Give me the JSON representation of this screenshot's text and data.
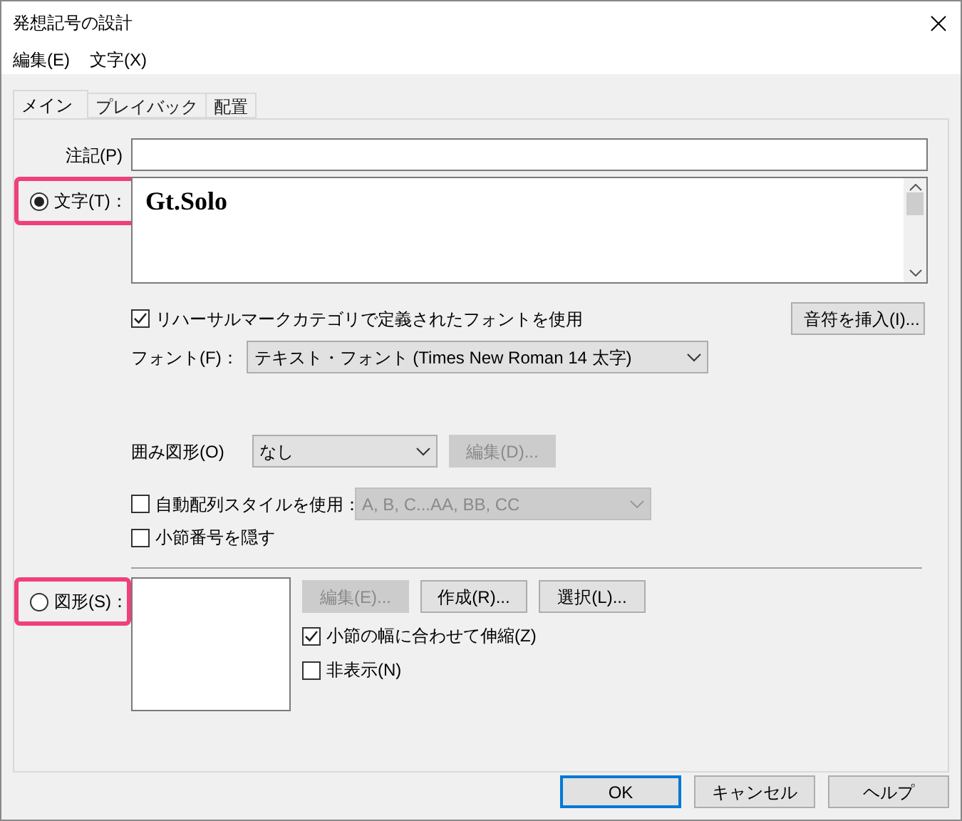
{
  "window": {
    "title": "発想記号の設計"
  },
  "menu": [
    "編集(E)",
    "文字(X)"
  ],
  "tabs": [
    {
      "label": "メイン",
      "selected": true
    },
    {
      "label": "プレイバック",
      "selected": false
    },
    {
      "label": "配置",
      "selected": false
    }
  ],
  "annotation": {
    "label": "注記(P)"
  },
  "text_option": {
    "label": "文字(T)：",
    "selected": true,
    "value": "Gt.Solo",
    "highlighted": true
  },
  "rehearsal_font": {
    "label": "リハーサルマークカテゴリで定義されたフォントを使用",
    "checked": true
  },
  "insert_note_button": "音符を挿入(I)...",
  "font": {
    "label": "フォント(F)：",
    "value": "テキスト・フォント (Times New Roman 14 太字)"
  },
  "enclosure": {
    "label": "囲み図形(O)",
    "value": "なし",
    "edit_button": {
      "label": "編集(D)...",
      "disabled": true
    }
  },
  "auto_sequence": {
    "label": "自動配列スタイルを使用：",
    "checked": false,
    "value": "A, B, C...AA, BB, CC",
    "disabled": true
  },
  "hide_measure_number": {
    "label": "小節番号を隠す",
    "checked": false
  },
  "shape_option": {
    "label": "図形(S)：",
    "selected": false,
    "highlighted": true
  },
  "shape_buttons": [
    {
      "label": "編集(E)...",
      "disabled": true
    },
    {
      "label": "作成(R)...",
      "disabled": false
    },
    {
      "label": "選択(L)...",
      "disabled": false
    }
  ],
  "shape_checks": [
    {
      "label": "小節の幅に合わせて伸縮(Z)",
      "checked": true
    },
    {
      "label": "非表示(N)",
      "checked": false
    }
  ],
  "footer_buttons": [
    {
      "label": "OK",
      "default": true
    },
    {
      "label": "キャンセル",
      "default": false
    },
    {
      "label": "ヘルプ",
      "default": false
    }
  ]
}
